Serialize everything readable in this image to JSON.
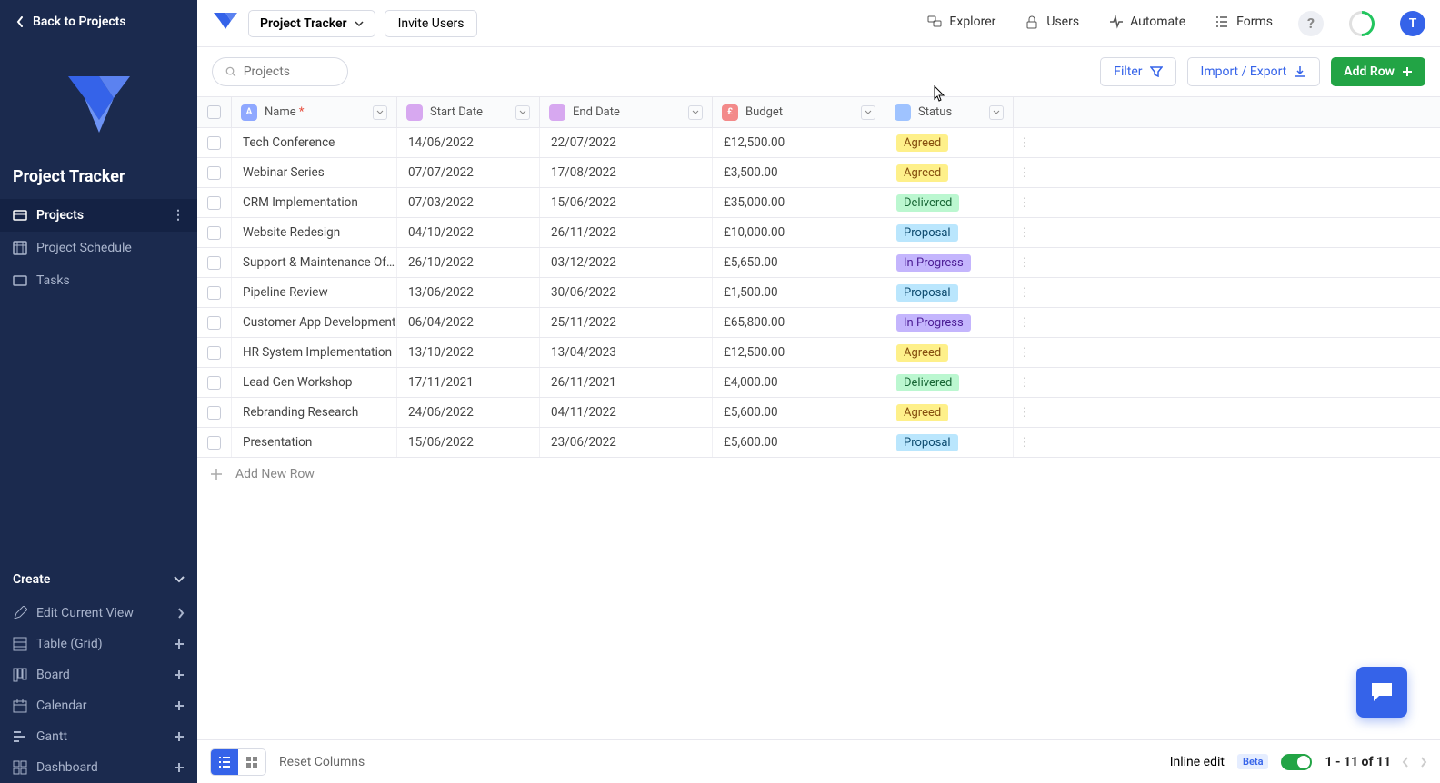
{
  "back_label": "Back to Projects",
  "app_title": "Project Tracker",
  "sidebar_nav": [
    {
      "label": "Projects",
      "active": true
    },
    {
      "label": "Project Schedule",
      "active": false
    },
    {
      "label": "Tasks",
      "active": false
    }
  ],
  "create_header": "Create",
  "create_items": [
    {
      "label": "Edit Current View",
      "trail": "chevron"
    },
    {
      "label": "Table (Grid)",
      "trail": "plus"
    },
    {
      "label": "Board",
      "trail": "plus"
    },
    {
      "label": "Calendar",
      "trail": "plus"
    },
    {
      "label": "Gantt",
      "trail": "plus"
    },
    {
      "label": "Dashboard",
      "trail": "plus"
    }
  ],
  "topbar": {
    "project_dropdown": "Project Tracker",
    "invite": "Invite Users",
    "links": [
      {
        "label": "Explorer",
        "icon": "explorer"
      },
      {
        "label": "Users",
        "icon": "lock"
      },
      {
        "label": "Automate",
        "icon": "automate"
      },
      {
        "label": "Forms",
        "icon": "forms"
      }
    ],
    "avatar_letter": "T"
  },
  "toolbar": {
    "search_placeholder": "Projects",
    "filter": "Filter",
    "import_export": "Import / Export",
    "add_row": "Add Row"
  },
  "columns": [
    {
      "label": "Name",
      "req": true,
      "icon": "A"
    },
    {
      "label": "Start Date",
      "req": false,
      "icon": "D"
    },
    {
      "label": "End Date",
      "req": false,
      "icon": "D"
    },
    {
      "label": "Budget",
      "req": false,
      "icon": "£"
    },
    {
      "label": "Status",
      "req": false,
      "icon": "S"
    }
  ],
  "rows": [
    {
      "name": "Tech Conference",
      "start": "14/06/2022",
      "end": "22/07/2022",
      "budget": "£12,500.00",
      "status": "Agreed"
    },
    {
      "name": "Webinar Series",
      "start": "07/07/2022",
      "end": "17/08/2022",
      "budget": "£3,500.00",
      "status": "Agreed"
    },
    {
      "name": "CRM Implementation",
      "start": "07/03/2022",
      "end": "15/06/2022",
      "budget": "£35,000.00",
      "status": "Delivered"
    },
    {
      "name": "Website Redesign",
      "start": "04/10/2022",
      "end": "26/11/2022",
      "budget": "£10,000.00",
      "status": "Proposal"
    },
    {
      "name": "Support & Maintenance Of…",
      "start": "26/10/2022",
      "end": "03/12/2022",
      "budget": "£5,650.00",
      "status": "In Progress"
    },
    {
      "name": "Pipeline Review",
      "start": "13/06/2022",
      "end": "30/06/2022",
      "budget": "£1,500.00",
      "status": "Proposal"
    },
    {
      "name": "Customer App Development",
      "start": "06/04/2022",
      "end": "25/11/2022",
      "budget": "£65,800.00",
      "status": "In Progress"
    },
    {
      "name": "HR System Implementation",
      "start": "13/10/2022",
      "end": "13/04/2023",
      "budget": "£12,500.00",
      "status": "Agreed"
    },
    {
      "name": "Lead Gen Workshop",
      "start": "17/11/2021",
      "end": "26/11/2021",
      "budget": "£4,000.00",
      "status": "Delivered"
    },
    {
      "name": "Rebranding Research",
      "start": "24/06/2022",
      "end": "04/11/2022",
      "budget": "£5,600.00",
      "status": "Agreed"
    },
    {
      "name": "Presentation",
      "start": "15/06/2022",
      "end": "23/06/2022",
      "budget": "£5,600.00",
      "status": "Proposal"
    }
  ],
  "add_new_row": "Add New Row",
  "footer": {
    "reset": "Reset Columns",
    "inline_edit": "Inline edit",
    "beta": "Beta",
    "pager": "1 - 11 of 11"
  }
}
